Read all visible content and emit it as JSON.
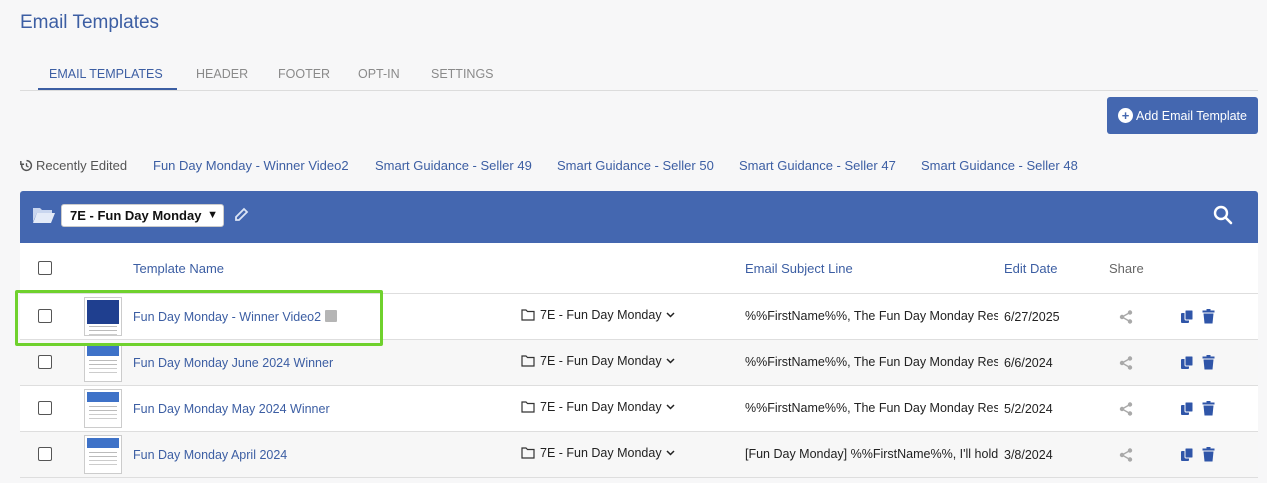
{
  "page_title": "Email Templates",
  "tabs": [
    {
      "label": "EMAIL TEMPLATES",
      "active": true
    },
    {
      "label": "HEADER",
      "active": false
    },
    {
      "label": "FOOTER",
      "active": false
    },
    {
      "label": "OPT-IN",
      "active": false
    },
    {
      "label": "SETTINGS",
      "active": false
    }
  ],
  "add_button": {
    "label": "Add Email Template",
    "icon": "plus-circle-icon"
  },
  "recent": {
    "label": "Recently Edited",
    "icon": "history-icon",
    "links": [
      "Fun Day Monday - Winner Video2",
      "Smart Guidance - Seller 49",
      "Smart Guidance - Seller 50",
      "Smart Guidance - Seller 47",
      "Smart Guidance - Seller 48"
    ]
  },
  "folder_bar": {
    "selected_folder": "7E - Fun Day Monday",
    "icons": [
      "folder-open-icon",
      "pencil-icon",
      "search-icon"
    ]
  },
  "table": {
    "headers": {
      "name": "Template Name",
      "subject": "Email Subject Line",
      "date": "Edit Date",
      "share": "Share"
    },
    "rows": [
      {
        "name": "Fun Day Monday - Winner Video2",
        "folder": "7E - Fun Day Monday",
        "subject": "%%FirstName%%, The Fun Day Monday Results Are In",
        "date": "6/27/2025",
        "thumb": "dark",
        "highlighted": true
      },
      {
        "name": "Fun Day Monday June 2024 Winner",
        "folder": "7E - Fun Day Monday",
        "subject": "%%FirstName%%, The Fun Day Monday Results Are In",
        "date": "6/6/2024",
        "thumb": "light",
        "highlighted": false
      },
      {
        "name": "Fun Day Monday May 2024 Winner",
        "folder": "7E - Fun Day Monday",
        "subject": "%%FirstName%%, The Fun Day Monday Results Are In",
        "date": "5/2/2024",
        "thumb": "light",
        "highlighted": false
      },
      {
        "name": "Fun Day Monday April 2024",
        "folder": "7E - Fun Day Monday",
        "subject": "[Fun Day Monday] %%FirstName%%, I'll hold a spot for you",
        "date": "3/8/2024",
        "thumb": "light",
        "highlighted": false
      }
    ]
  },
  "colors": {
    "accent": "#4467b0",
    "link": "#3c5ea3",
    "highlight": "#6fd12d"
  }
}
